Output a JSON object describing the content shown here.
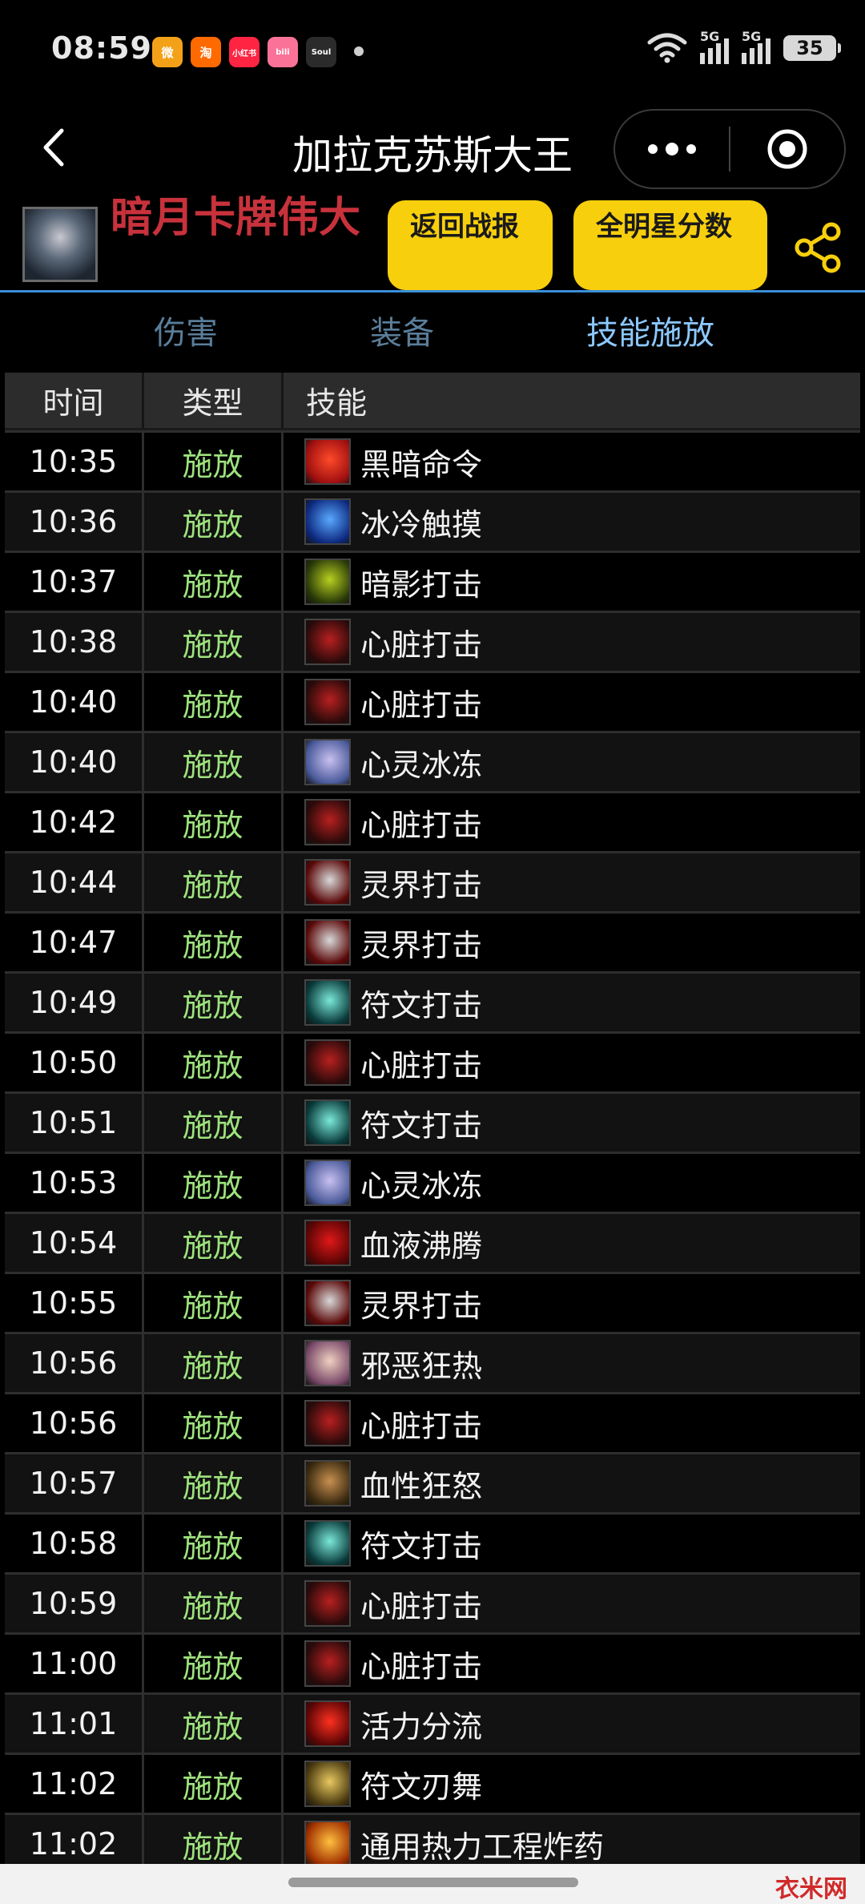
{
  "status_bar": {
    "time": "08:59",
    "apps": [
      {
        "icon": "weibo-icon",
        "label": "微",
        "color": "#f4a11a"
      },
      {
        "icon": "taobao-icon",
        "label": "淘",
        "color": "#ff6a00"
      },
      {
        "icon": "xiaohongshu-icon",
        "label": "小红书",
        "color": "#ff2442"
      },
      {
        "icon": "bilibili-icon",
        "label": "bili",
        "color": "#fb7299"
      },
      {
        "icon": "soul-icon",
        "label": "Soul",
        "color": "#2b2b2b"
      }
    ],
    "signal_1_label": "5G",
    "signal_2_label": "5G",
    "battery": "35"
  },
  "nav": {
    "title": "加拉克苏斯大王"
  },
  "profile": {
    "player_name": "暗月卡牌伟大",
    "return_button": "返回战报",
    "allstar_button": "全明星分数"
  },
  "tabs": [
    {
      "label": "伤害",
      "active": false
    },
    {
      "label": "装备",
      "active": false
    },
    {
      "label": "技能施放",
      "active": true
    }
  ],
  "table": {
    "headers": {
      "time": "时间",
      "type": "类型",
      "skill": "技能"
    },
    "rows": [
      {
        "time": "10:35",
        "type": "施放",
        "skill": "黑暗命令",
        "icon": "dark-command-icon",
        "c1": "#a01010",
        "c2": "#ff4a2a"
      },
      {
        "time": "10:36",
        "type": "施放",
        "skill": "冰冷触摸",
        "icon": "icy-touch-icon",
        "c1": "#0d2a80",
        "c2": "#5aa8ff"
      },
      {
        "time": "10:37",
        "type": "施放",
        "skill": "暗影打击",
        "icon": "shadow-strike-icon",
        "c1": "#2a3a08",
        "c2": "#b8d020"
      },
      {
        "time": "10:38",
        "type": "施放",
        "skill": "心脏打击",
        "icon": "heart-strike-icon",
        "c1": "#2a0a0a",
        "c2": "#b82020"
      },
      {
        "time": "10:40",
        "type": "施放",
        "skill": "心脏打击",
        "icon": "heart-strike-icon",
        "c1": "#2a0a0a",
        "c2": "#b82020"
      },
      {
        "time": "10:40",
        "type": "施放",
        "skill": "心灵冰冻",
        "icon": "mind-freeze-icon",
        "c1": "#4a5a9a",
        "c2": "#c8c0f0"
      },
      {
        "time": "10:42",
        "type": "施放",
        "skill": "心脏打击",
        "icon": "heart-strike-icon",
        "c1": "#2a0a0a",
        "c2": "#b82020"
      },
      {
        "time": "10:44",
        "type": "施放",
        "skill": "灵界打击",
        "icon": "death-strike-icon",
        "c1": "#5a0808",
        "c2": "#d8d8d8"
      },
      {
        "time": "10:47",
        "type": "施放",
        "skill": "灵界打击",
        "icon": "death-strike-icon",
        "c1": "#5a0808",
        "c2": "#d8d8d8"
      },
      {
        "time": "10:49",
        "type": "施放",
        "skill": "符文打击",
        "icon": "rune-strike-icon",
        "c1": "#0a3a3a",
        "c2": "#7ae8d8"
      },
      {
        "time": "10:50",
        "type": "施放",
        "skill": "心脏打击",
        "icon": "heart-strike-icon",
        "c1": "#2a0a0a",
        "c2": "#b82020"
      },
      {
        "time": "10:51",
        "type": "施放",
        "skill": "符文打击",
        "icon": "rune-strike-icon",
        "c1": "#0a3a3a",
        "c2": "#7ae8d8"
      },
      {
        "time": "10:53",
        "type": "施放",
        "skill": "心灵冰冻",
        "icon": "mind-freeze-icon",
        "c1": "#4a5a9a",
        "c2": "#c8c0f0"
      },
      {
        "time": "10:54",
        "type": "施放",
        "skill": "血液沸腾",
        "icon": "blood-boil-icon",
        "c1": "#5a0505",
        "c2": "#e01818"
      },
      {
        "time": "10:55",
        "type": "施放",
        "skill": "灵界打击",
        "icon": "death-strike-icon",
        "c1": "#5a0808",
        "c2": "#d8d8d8"
      },
      {
        "time": "10:56",
        "type": "施放",
        "skill": "邪恶狂热",
        "icon": "unholy-frenzy-icon",
        "c1": "#7a4a6a",
        "c2": "#f0d0c0"
      },
      {
        "time": "10:56",
        "type": "施放",
        "skill": "心脏打击",
        "icon": "heart-strike-icon",
        "c1": "#2a0a0a",
        "c2": "#b82020"
      },
      {
        "time": "10:57",
        "type": "施放",
        "skill": "血性狂怒",
        "icon": "blood-fury-icon",
        "c1": "#3a2a10",
        "c2": "#c89050"
      },
      {
        "time": "10:58",
        "type": "施放",
        "skill": "符文打击",
        "icon": "rune-strike-icon",
        "c1": "#0a3a3a",
        "c2": "#7ae8d8"
      },
      {
        "time": "10:59",
        "type": "施放",
        "skill": "心脏打击",
        "icon": "heart-strike-icon",
        "c1": "#2a0a0a",
        "c2": "#b82020"
      },
      {
        "time": "11:00",
        "type": "施放",
        "skill": "心脏打击",
        "icon": "heart-strike-icon",
        "c1": "#2a0a0a",
        "c2": "#b82020"
      },
      {
        "time": "11:01",
        "type": "施放",
        "skill": "活力分流",
        "icon": "vampiric-blood-icon",
        "c1": "#5a0505",
        "c2": "#ff3020"
      },
      {
        "time": "11:02",
        "type": "施放",
        "skill": "符文刃舞",
        "icon": "dancing-rune-weapon-icon",
        "c1": "#4a3a10",
        "c2": "#e8c860"
      },
      {
        "time": "11:02",
        "type": "施放",
        "skill": "通用热力工程炸药",
        "icon": "explosive-icon",
        "c1": "#a03000",
        "c2": "#ffc040"
      }
    ]
  },
  "watermark": "衣米网"
}
